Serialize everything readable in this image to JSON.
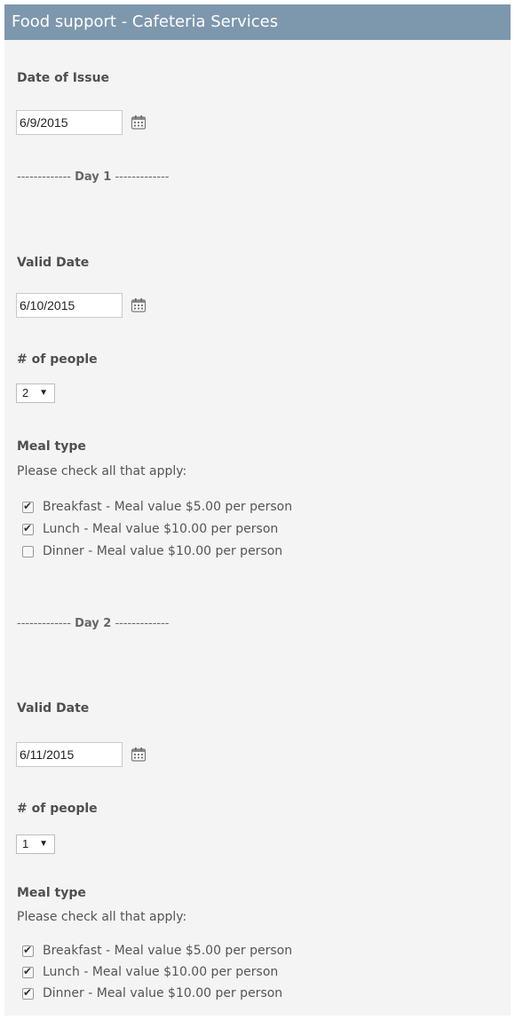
{
  "header": {
    "title": "Food support - Cafeteria Services"
  },
  "issue": {
    "label": "Date of Issue",
    "value": "6/9/2015"
  },
  "days": [
    {
      "divider_left": "-------------",
      "divider_day": "Day 1",
      "divider_right": "-------------",
      "valid_label": "Valid Date",
      "valid_value": "6/10/2015",
      "people_label": "# of people",
      "people_value": "2",
      "meal_label": "Meal type",
      "meal_hint": "Please check all that apply:",
      "meals": [
        {
          "label": "Breakfast - Meal value $5.00 per person",
          "checked": true
        },
        {
          "label": "Lunch - Meal value $10.00 per person",
          "checked": true
        },
        {
          "label": "Dinner - Meal value $10.00 per person",
          "checked": false
        }
      ]
    },
    {
      "divider_left": "-------------",
      "divider_day": "Day 2",
      "divider_right": "-------------",
      "valid_label": "Valid Date",
      "valid_value": "6/11/2015",
      "people_label": "# of people",
      "people_value": "1",
      "meal_label": "Meal type",
      "meal_hint": "Please check all that apply:",
      "meals": [
        {
          "label": "Breakfast - Meal value $5.00 per person",
          "checked": true
        },
        {
          "label": "Lunch - Meal value $10.00 per person",
          "checked": true
        },
        {
          "label": "Dinner - Meal value $10.00 per person",
          "checked": true
        }
      ]
    }
  ],
  "icons": {
    "calendar": "calendar-icon",
    "dropdown": "chevron-down-icon"
  }
}
